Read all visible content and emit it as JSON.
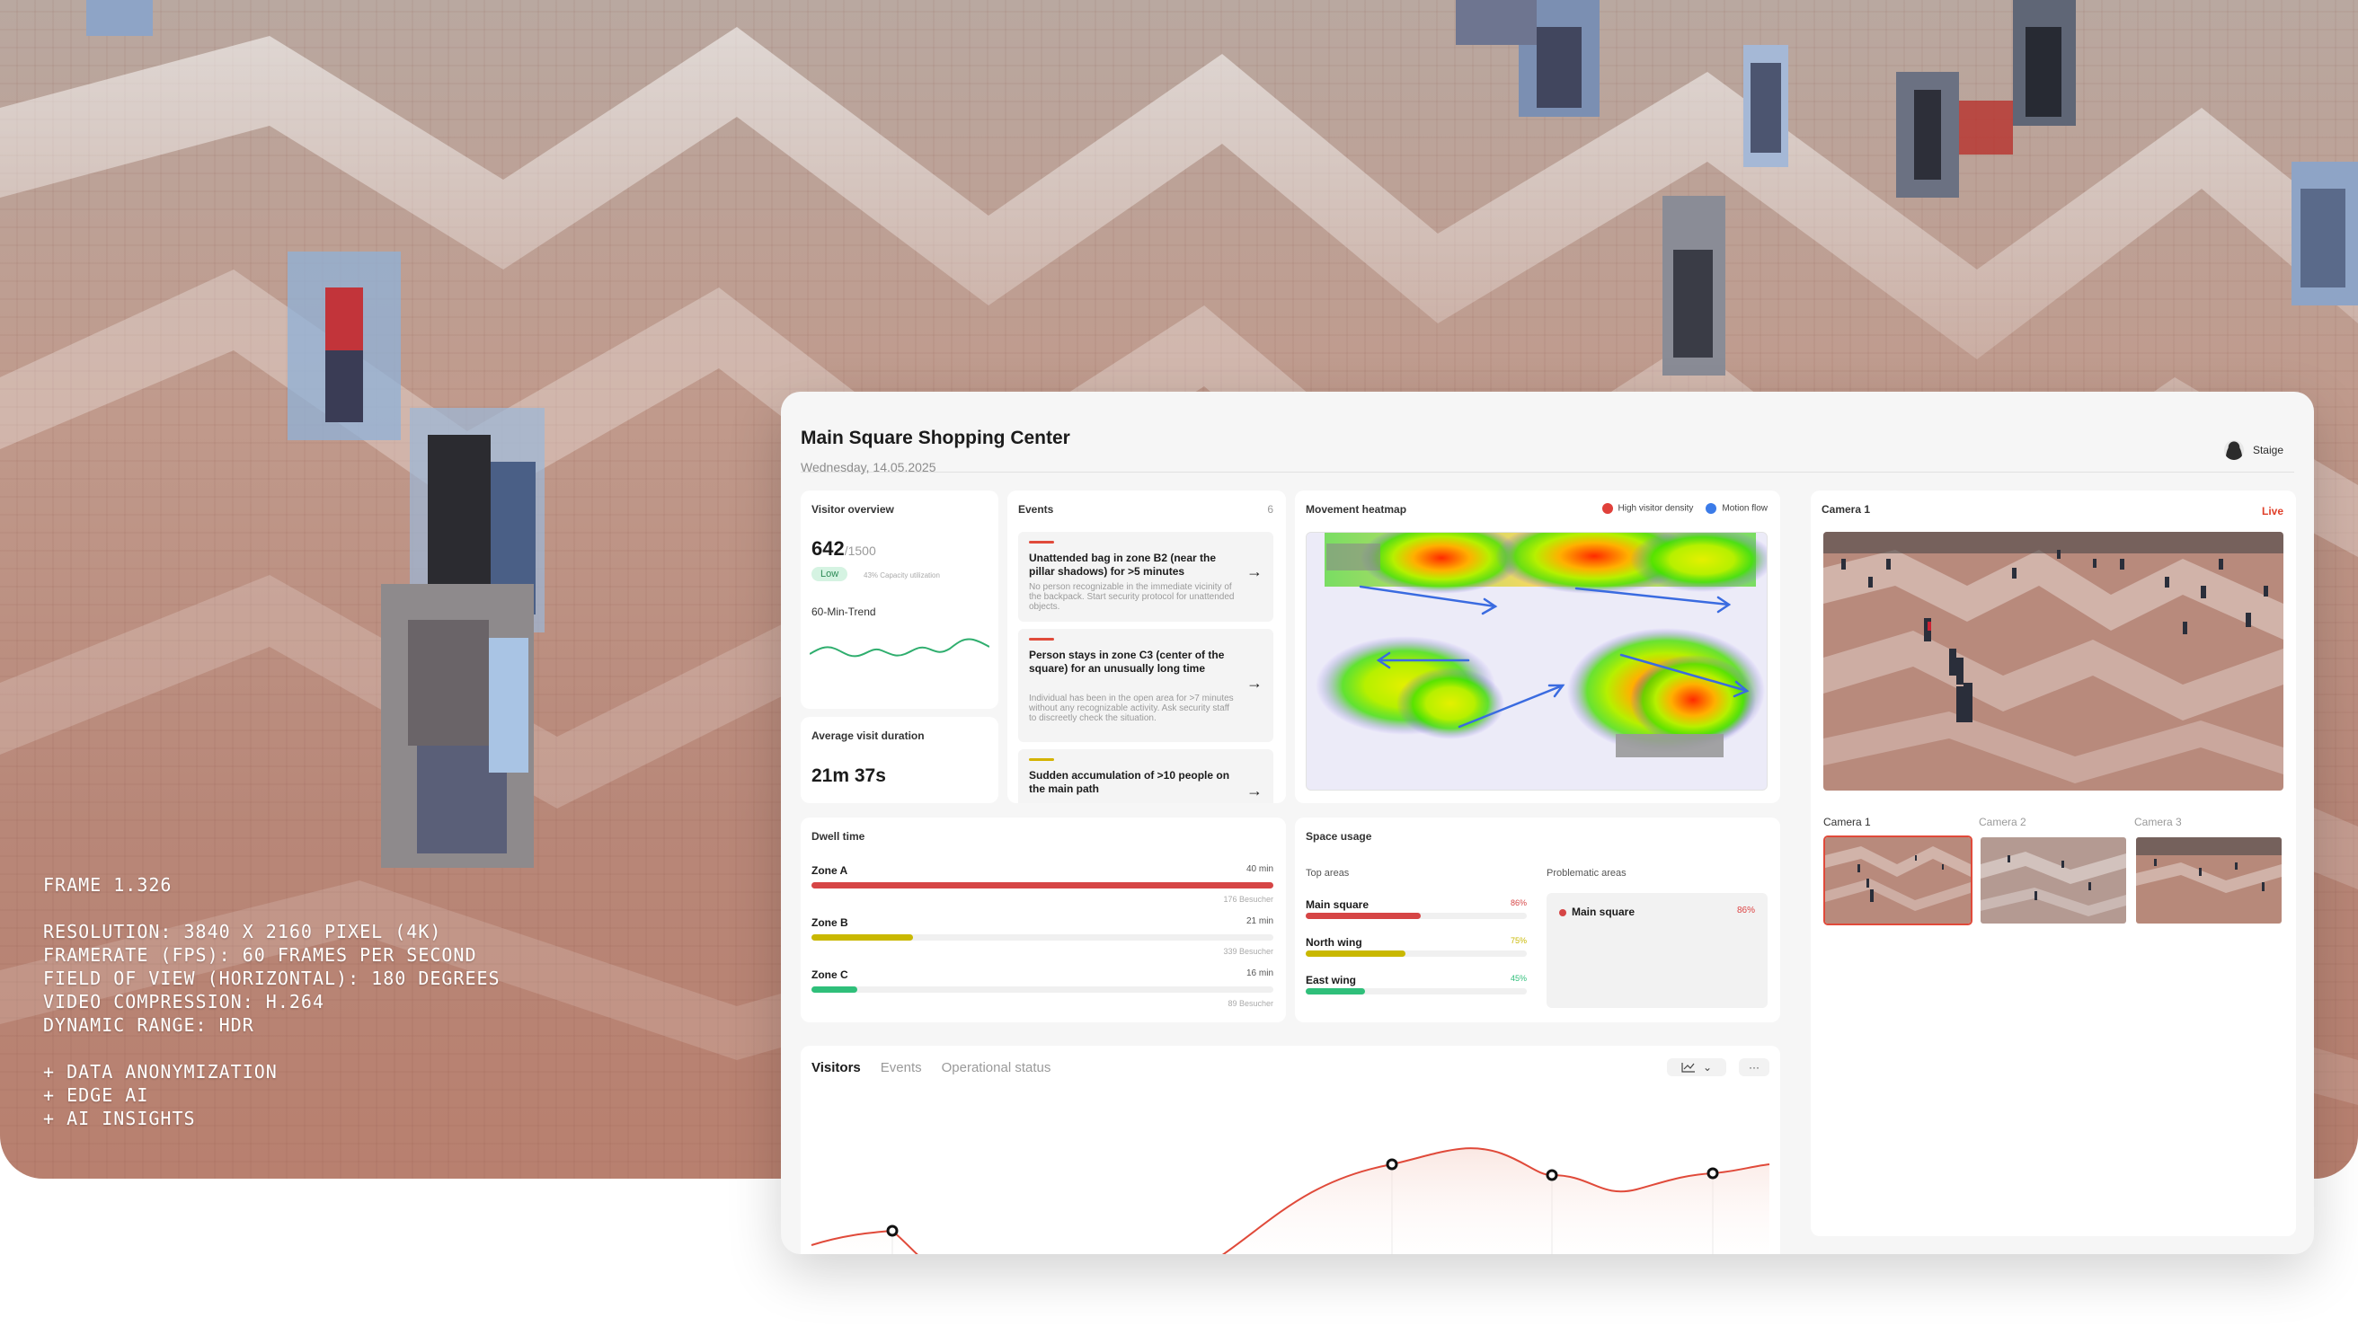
{
  "overlay": {
    "frame": "FRAME 1.326",
    "specs": [
      "RESOLUTION: 3840 X 2160 PIXEL (4K)",
      "FRAMERATE (FPS): 60 FRAMES PER SECOND",
      "FIELD OF VIEW (HORIZONTAL): 180 DEGREES",
      "VIDEO COMPRESSION: H.264",
      "DYNAMIC RANGE: HDR"
    ],
    "features": [
      "+ DATA ANONYMIZATION",
      "+ EDGE AI",
      "+ AI INSIGHTS"
    ]
  },
  "header": {
    "title": "Main Square Shopping Center",
    "date": "Wednesday, 14.05.2025",
    "user": "Staige"
  },
  "visitor_overview": {
    "title": "Visitor overview",
    "count": "642",
    "capacity": "/1500",
    "badge": "Low",
    "utilization": "43% Capacity utilization",
    "trend_label": "60-Min-Trend"
  },
  "avg_duration": {
    "title": "Average visit duration",
    "value": "21m 37s"
  },
  "events": {
    "title": "Events",
    "count": "6",
    "items": [
      {
        "title": "Unattended bag in zone B2 (near the pillar shadows) for >5 minutes",
        "desc": "No person recognizable in the immediate vicinity of the backpack. Start security protocol for unattended objects.",
        "severity_color": "#e04a3a"
      },
      {
        "title": "Person stays in zone C3 (center of the square) for an unusually long time",
        "desc": "Individual has been in the open area for >7 minutes without any recognizable activity. Ask security staff to discreetly check the situation.",
        "severity_color": "#e04a3a"
      },
      {
        "title": "Sudden accumulation of >10 people on the main path",
        "desc": "",
        "severity_color": "#d4b300"
      }
    ]
  },
  "heatmap": {
    "title": "Movement heatmap",
    "legend": [
      {
        "label": "High visitor density",
        "color": "#e0403a"
      },
      {
        "label": "Motion flow",
        "color": "#3b7be8"
      }
    ]
  },
  "camera": {
    "title": "Camera 1",
    "status": "Live",
    "thumbs": [
      {
        "label": "Camera 1",
        "active": true
      },
      {
        "label": "Camera 2",
        "active": false
      },
      {
        "label": "Camera 3",
        "active": false
      }
    ]
  },
  "dwell": {
    "title": "Dwell time",
    "zones": [
      {
        "name": "Zone A",
        "time": "40 min",
        "visitors": "176 Besucher",
        "fraction": 1.0,
        "color": "#d64545"
      },
      {
        "name": "Zone B",
        "time": "21 min",
        "visitors": "339 Besucher",
        "fraction": 0.22,
        "color": "#c9b800"
      },
      {
        "name": "Zone C",
        "time": "16 min",
        "visitors": "89 Besucher",
        "fraction": 0.1,
        "color": "#2fbf7a"
      }
    ]
  },
  "space": {
    "title": "Space usage",
    "top_label": "Top areas",
    "problem_label": "Problematic areas",
    "areas": [
      {
        "name": "Main square",
        "pct": "86%",
        "fraction": 0.52,
        "color": "#d64545"
      },
      {
        "name": "North wing",
        "pct": "75%",
        "fraction": 0.45,
        "color": "#c9b800"
      },
      {
        "name": "East wing",
        "pct": "45%",
        "fraction": 0.27,
        "color": "#2fbf7a"
      }
    ],
    "problem": {
      "name": "Main square",
      "pct": "86%",
      "color": "#d64545"
    }
  },
  "chart_tabs": {
    "tabs": [
      "Visitors",
      "Events",
      "Operational status"
    ],
    "active": "Visitors",
    "more": "···"
  }
}
